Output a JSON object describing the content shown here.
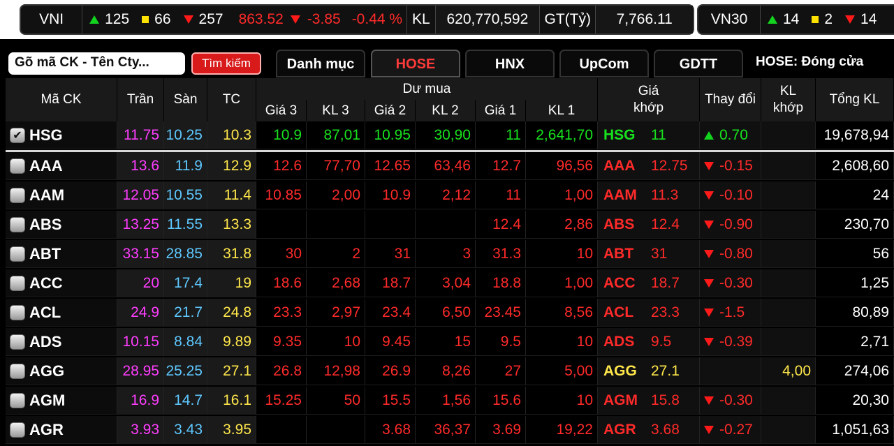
{
  "vni": {
    "label": "VNI",
    "up": "125",
    "flat": "66",
    "down": "257",
    "index": "863.52",
    "change": "-3.85",
    "pct": "-0.44 %",
    "kl_label": "KL",
    "volume": "620,770,592",
    "gt_label": "GT(Tỷ)",
    "value": "7,766.11"
  },
  "vn30": {
    "label": "VN30",
    "up": "14",
    "flat": "2",
    "down": "14"
  },
  "toolbar": {
    "search_placeholder": "Gõ mã CK - Tên Cty...",
    "search_button": "Tìm kiếm",
    "tabs": [
      "Danh mục",
      "HOSE",
      "HNX",
      "UpCom",
      "GDTT"
    ],
    "active_tab": "HOSE",
    "session": "HOSE:  Đóng cửa"
  },
  "headers": {
    "symbol": "Mã CK",
    "ceiling": "Trần",
    "floor": "Sàn",
    "ref": "TC",
    "bid_group": "Dư mua",
    "g3": "Giá 3",
    "kl3": "KL 3",
    "g2": "Giá 2",
    "kl2": "KL 2",
    "g1": "Giá 1",
    "kl1": "KL 1",
    "match_price": "Giá khớp",
    "change": "Thay đổi",
    "match_vol": "KL khớp",
    "total_vol": "Tổng KL"
  },
  "colors": {
    "up": "#18e21e",
    "down": "#ff2a2a",
    "ref": "#ffe74b",
    "ceiling": "#ff3dff",
    "floor": "#5ec8ff"
  },
  "rows": [
    {
      "sym": "HSG",
      "checked": true,
      "ceil": "11.75",
      "floor": "10.25",
      "ref": "10.3",
      "g3": "10.9",
      "k3": "87,01",
      "g2": "10.95",
      "k2": "30,90",
      "g1": "11",
      "k1": "2,641,70",
      "mp": "11",
      "chg": "0.70",
      "dir": "up",
      "mv": "",
      "tot": "19,678,94"
    },
    {
      "sym": "AAA",
      "checked": false,
      "ceil": "13.6",
      "floor": "11.9",
      "ref": "12.9",
      "g3": "12.6",
      "k3": "77,70",
      "g2": "12.65",
      "k2": "63,46",
      "g1": "12.7",
      "k1": "96,56",
      "mp": "12.75",
      "chg": "-0.15",
      "dir": "down",
      "mv": "",
      "tot": "2,608,60"
    },
    {
      "sym": "AAM",
      "checked": false,
      "ceil": "12.05",
      "floor": "10.55",
      "ref": "11.4",
      "g3": "10.85",
      "k3": "2,00",
      "g2": "10.9",
      "k2": "2,12",
      "g1": "11",
      "k1": "1,00",
      "mp": "11.3",
      "chg": "-0.10",
      "dir": "down",
      "mv": "",
      "tot": "24"
    },
    {
      "sym": "ABS",
      "checked": false,
      "ceil": "13.25",
      "floor": "11.55",
      "ref": "13.3",
      "g3": "",
      "k3": "",
      "g2": "",
      "k2": "",
      "g1": "12.4",
      "k1": "2,86",
      "mp": "12.4",
      "chg": "-0.90",
      "dir": "down",
      "mv": "",
      "tot": "230,70"
    },
    {
      "sym": "ABT",
      "checked": false,
      "ceil": "33.15",
      "floor": "28.85",
      "ref": "31.8",
      "g3": "30",
      "k3": "2",
      "g2": "31",
      "k2": "3",
      "g1": "31.3",
      "k1": "10",
      "mp": "31",
      "chg": "-0.80",
      "dir": "down",
      "mv": "",
      "tot": "56"
    },
    {
      "sym": "ACC",
      "checked": false,
      "ceil": "20",
      "floor": "17.4",
      "ref": "19",
      "g3": "18.6",
      "k3": "2,68",
      "g2": "18.7",
      "k2": "3,04",
      "g1": "18.8",
      "k1": "1,00",
      "mp": "18.7",
      "chg": "-0.30",
      "dir": "down",
      "mv": "",
      "tot": "1,25"
    },
    {
      "sym": "ACL",
      "checked": false,
      "ceil": "24.9",
      "floor": "21.7",
      "ref": "24.8",
      "g3": "23.3",
      "k3": "2,97",
      "g2": "23.4",
      "k2": "6,50",
      "g1": "23.45",
      "k1": "8,56",
      "mp": "23.3",
      "chg": "-1.5",
      "dir": "down",
      "mv": "",
      "tot": "80,89"
    },
    {
      "sym": "ADS",
      "checked": false,
      "ceil": "10.15",
      "floor": "8.84",
      "ref": "9.89",
      "g3": "9.35",
      "k3": "10",
      "g2": "9.45",
      "k2": "15",
      "g1": "9.5",
      "k1": "10",
      "mp": "9.5",
      "chg": "-0.39",
      "dir": "down",
      "mv": "",
      "tot": "2,71"
    },
    {
      "sym": "AGG",
      "checked": false,
      "ceil": "28.95",
      "floor": "25.25",
      "ref": "27.1",
      "g3": "26.8",
      "k3": "12,98",
      "g2": "26.9",
      "k2": "8,26",
      "g1": "27",
      "k1": "5,00",
      "mp": "27.1",
      "chg": "",
      "dir": "ref",
      "mv": "4,00",
      "tot": "274,06"
    },
    {
      "sym": "AGM",
      "checked": false,
      "ceil": "16.9",
      "floor": "14.7",
      "ref": "16.1",
      "g3": "15.25",
      "k3": "50",
      "g2": "15.5",
      "k2": "1,56",
      "g1": "15.6",
      "k1": "10",
      "mp": "15.8",
      "chg": "-0.30",
      "dir": "down",
      "mv": "",
      "tot": "20,30"
    },
    {
      "sym": "AGR",
      "checked": false,
      "ceil": "3.93",
      "floor": "3.43",
      "ref": "3.95",
      "g3": "",
      "k3": "",
      "g2": "3.68",
      "k2": "36,37",
      "g1": "3.69",
      "k1": "19,22",
      "mp": "3.68",
      "chg": "-0.27",
      "dir": "down",
      "mv": "",
      "tot": "1,051,63"
    }
  ]
}
